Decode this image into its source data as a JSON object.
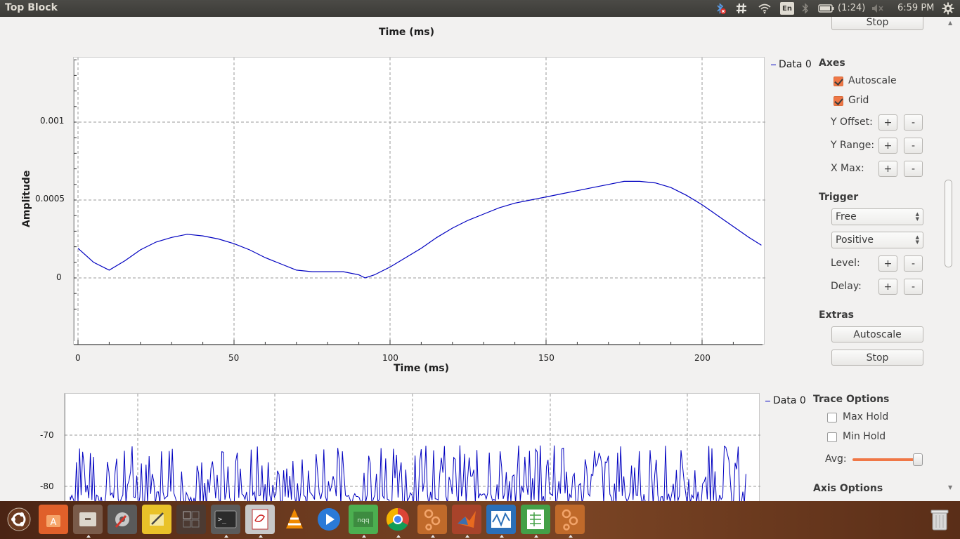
{
  "window": {
    "title": "Top Block"
  },
  "panel": {
    "battery_text": "(1:24)",
    "clock": "6:59 PM",
    "keyboard": "En",
    "icons": [
      "bluetooth-error-icon",
      "hash-network-icon",
      "wifi-icon",
      "keyboard-layout-icon",
      "bluetooth-icon",
      "battery-icon",
      "volume-muted-icon",
      "gear-icon"
    ]
  },
  "top_partial_plot": {
    "xlabel": "Time (ms)",
    "stop_label": "Stop"
  },
  "time_plot": {
    "legend": "Data 0",
    "ylabel": "Amplitude",
    "xlabel": "Time (ms)",
    "ytick_labels": [
      "0.001",
      "0.0005",
      "0"
    ],
    "xtick_labels": [
      "0",
      "50",
      "100",
      "150",
      "200"
    ],
    "line_color": "#0000c0"
  },
  "chart_data": [
    {
      "type": "line",
      "xlabel": "Time (ms)",
      "ylabel": "Amplitude",
      "xlim": [
        0,
        220
      ],
      "ylim": [
        -0.0002,
        0.00141
      ],
      "grid": true,
      "legend": "top-right",
      "series": [
        {
          "name": "Data 0",
          "x": [
            0,
            5,
            10,
            15,
            20,
            25,
            30,
            35,
            40,
            45,
            50,
            55,
            60,
            65,
            70,
            75,
            80,
            85,
            90,
            92,
            95,
            100,
            105,
            110,
            115,
            120,
            125,
            130,
            135,
            140,
            145,
            150,
            155,
            160,
            165,
            170,
            175,
            180,
            185,
            190,
            195,
            200,
            205,
            210,
            215,
            219
          ],
          "y": [
            0.00019,
            0.0001,
            5e-05,
            0.00011,
            0.00018,
            0.00023,
            0.00026,
            0.00028,
            0.00027,
            0.00025,
            0.00022,
            0.00018,
            0.00013,
            9e-05,
            5e-05,
            4e-05,
            4e-05,
            4e-05,
            2e-05,
            0.0,
            2e-05,
            7e-05,
            0.00013,
            0.00019,
            0.00026,
            0.00032,
            0.00037,
            0.00041,
            0.00045,
            0.00048,
            0.0005,
            0.00052,
            0.00054,
            0.00056,
            0.00058,
            0.0006,
            0.00062,
            0.00062,
            0.00061,
            0.00058,
            0.00053,
            0.00047,
            0.0004,
            0.00033,
            0.00026,
            0.00021
          ]
        }
      ]
    },
    {
      "type": "line",
      "legend_label": "Data 0",
      "ytick_labels": [
        "-70",
        "-80"
      ],
      "ylim": [
        -82,
        -60
      ],
      "grid": true,
      "note": "noisy spectrum trace, peaks between -72 and -80"
    }
  ],
  "freq_plot": {
    "legend": "Data 0",
    "ytick_labels": [
      "-70",
      "-80"
    ]
  },
  "axes_panel": {
    "title": "Axes",
    "autoscale_label": "Autoscale",
    "grid_label": "Grid",
    "y_offset_label": "Y Offset:",
    "y_range_label": "Y Range:",
    "x_max_label": "X Max:",
    "plus": "+",
    "minus": "-"
  },
  "trigger_panel": {
    "title": "Trigger",
    "mode_value": "Free",
    "slope_value": "Positive",
    "level_label": "Level:",
    "delay_label": "Delay:"
  },
  "extras_panel": {
    "title": "Extras",
    "autoscale_button": "Autoscale",
    "stop_button": "Stop"
  },
  "trace_options": {
    "title": "Trace Options",
    "max_hold_label": "Max Hold",
    "min_hold_label": "Min Hold",
    "avg_label": "Avg:",
    "axis_options_title": "Axis Options"
  },
  "launcher": {
    "items": [
      "ubuntu-home-icon",
      "software-center-icon",
      "files-icon",
      "system-settings-icon",
      "text-editor-icon",
      "workspace-switcher-icon",
      "terminal-icon",
      "document-viewer-icon",
      "vlc-icon",
      "media-player-icon",
      "nqq-editor-icon",
      "chrome-icon",
      "gnuradio-companion-icon",
      "matlab-icon",
      "system-monitor-icon",
      "spreadsheet-icon",
      "gnuradio-top-block-icon",
      "trash-icon"
    ]
  }
}
